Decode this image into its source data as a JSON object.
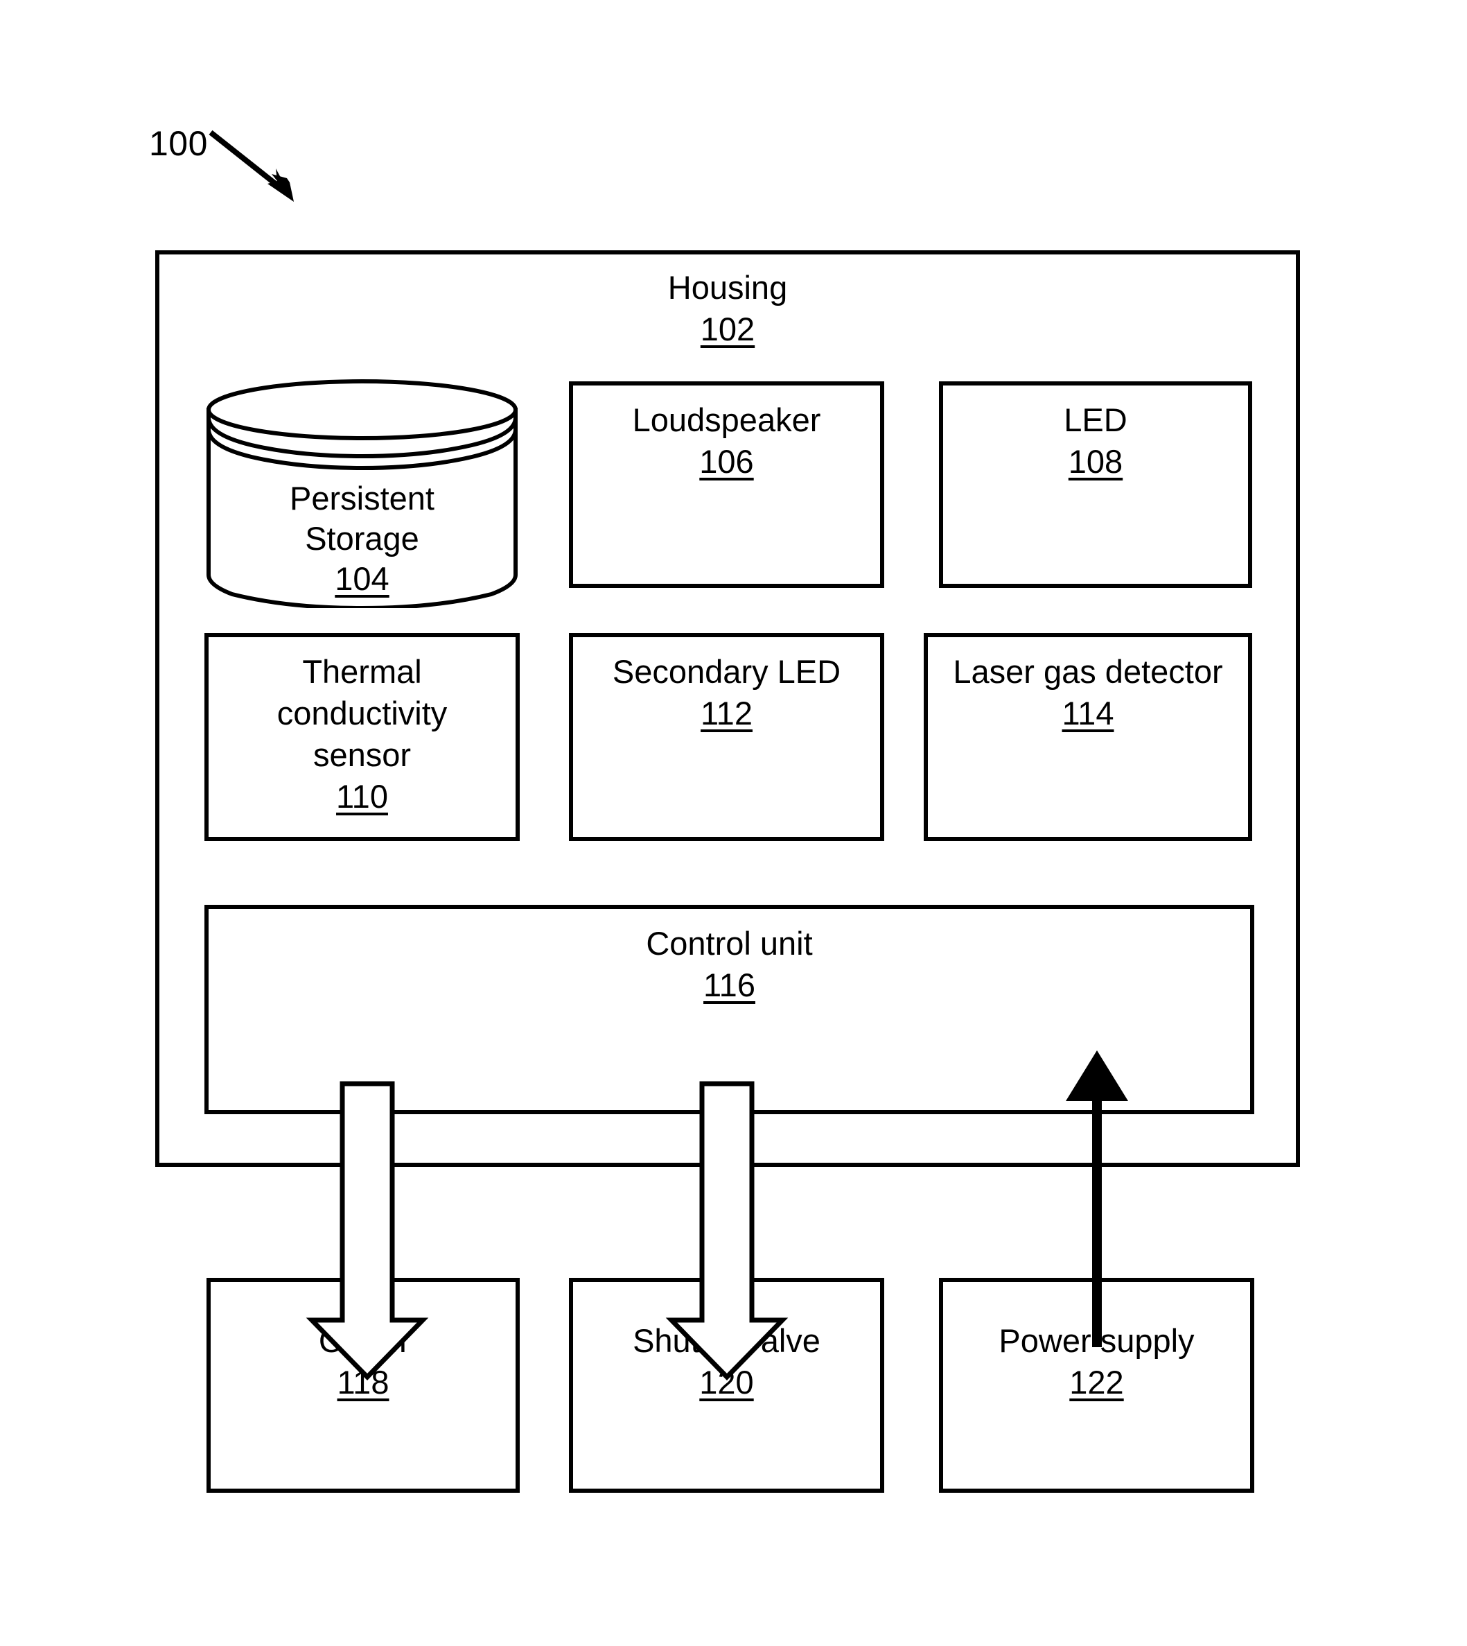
{
  "figure": {
    "reference_numeral": "100"
  },
  "housing": {
    "label": "Housing",
    "number": "102"
  },
  "components": {
    "persistent_storage": {
      "label_line1": "Persistent",
      "label_line2": "Storage",
      "number": "104"
    },
    "loudspeaker": {
      "label": "Loudspeaker",
      "number": "106"
    },
    "led": {
      "label": "LED",
      "number": "108"
    },
    "thermal_conductivity_sensor": {
      "label_line1": "Thermal",
      "label_line2": "conductivity",
      "label_line3": "sensor",
      "number": "110"
    },
    "secondary_led": {
      "label": "Secondary LED",
      "number": "112"
    },
    "laser_gas_detector": {
      "label": "Laser gas detector",
      "number": "114"
    },
    "control_unit": {
      "label": "Control unit",
      "number": "116"
    }
  },
  "external": {
    "obdii": {
      "label": "OBDII",
      "number": "118"
    },
    "shutoff_valve": {
      "label": "Shutoff valve",
      "number": "120"
    },
    "power_supply": {
      "label": "Power supply",
      "number": "122"
    }
  },
  "connectors": [
    {
      "name": "control-unit-to-obdii",
      "style": "hollow-block-arrow",
      "direction": "down"
    },
    {
      "name": "control-unit-to-shutoff-valve",
      "style": "hollow-block-arrow",
      "direction": "down"
    },
    {
      "name": "power-supply-to-control-unit",
      "style": "solid-line-arrow",
      "direction": "up"
    }
  ],
  "colors": {
    "stroke": "#000000",
    "background": "#ffffff"
  }
}
